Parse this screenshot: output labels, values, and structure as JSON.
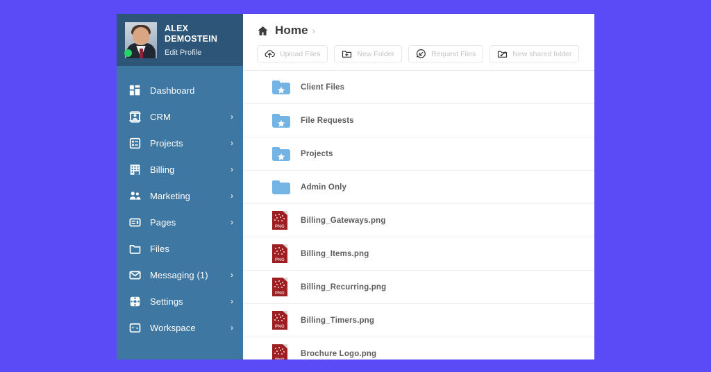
{
  "theme": {
    "page_background": "#5a4bf7",
    "sidebar_background": "#3e77a1",
    "profile_background": "#2d5577",
    "folder_color": "#74b4e4",
    "png_color": "#9e1f22",
    "status_dot_color": "#25d366"
  },
  "sidebar": {
    "profile": {
      "name": "ALEX DEMOSTEIN",
      "edit_link": "Edit Profile",
      "avatar_icon": "user-photo",
      "status_icon": "online-status-dot"
    },
    "items": [
      {
        "label": "Dashboard",
        "icon": "dashboard-grid-icon",
        "chevron": "",
        "has_chevron": false
      },
      {
        "label": "CRM",
        "icon": "contact-card-icon",
        "chevron": "›",
        "has_chevron": true
      },
      {
        "label": "Projects",
        "icon": "list-checklist-icon",
        "chevron": "›",
        "has_chevron": true
      },
      {
        "label": "Billing",
        "icon": "building-icon",
        "chevron": "›",
        "has_chevron": true
      },
      {
        "label": "Marketing",
        "icon": "people-group-icon",
        "chevron": "›",
        "has_chevron": true
      },
      {
        "label": "Pages",
        "icon": "page-layout-icon",
        "chevron": "›",
        "has_chevron": true
      },
      {
        "label": "Files",
        "icon": "folder-icon",
        "chevron": "",
        "has_chevron": false
      },
      {
        "label": "Messaging (1)",
        "icon": "envelope-icon",
        "chevron": "›",
        "has_chevron": true
      },
      {
        "label": "Settings",
        "icon": "gear-icon",
        "chevron": "›",
        "has_chevron": true
      },
      {
        "label": "Workspace",
        "icon": "workspace-arrows-icon",
        "chevron": "›",
        "has_chevron": true
      }
    ]
  },
  "breadcrumb": {
    "home_icon": "home-icon",
    "title": "Home",
    "separator": "›"
  },
  "toolbar": {
    "buttons": [
      {
        "label": "Upload Files",
        "icon": "cloud-upload-icon"
      },
      {
        "label": "New Folder",
        "icon": "folder-plus-icon"
      },
      {
        "label": "Request Files",
        "icon": "request-files-icon"
      },
      {
        "label": "New shared folder",
        "icon": "folder-share-icon"
      }
    ]
  },
  "file_list": {
    "rows": [
      {
        "name": "Client Files",
        "type": "folder",
        "starred": true
      },
      {
        "name": "File Requests",
        "type": "folder",
        "starred": true
      },
      {
        "name": "Projects",
        "type": "folder",
        "starred": true
      },
      {
        "name": "Admin Only",
        "type": "folder",
        "starred": false
      },
      {
        "name": "Billing_Gateways.png",
        "type": "png",
        "starred": false
      },
      {
        "name": "Billing_Items.png",
        "type": "png",
        "starred": false
      },
      {
        "name": "Billing_Recurring.png",
        "type": "png",
        "starred": false
      },
      {
        "name": "Billing_Timers.png",
        "type": "png",
        "starred": false
      },
      {
        "name": "Brochure Logo.png",
        "type": "png",
        "starred": false
      }
    ]
  }
}
